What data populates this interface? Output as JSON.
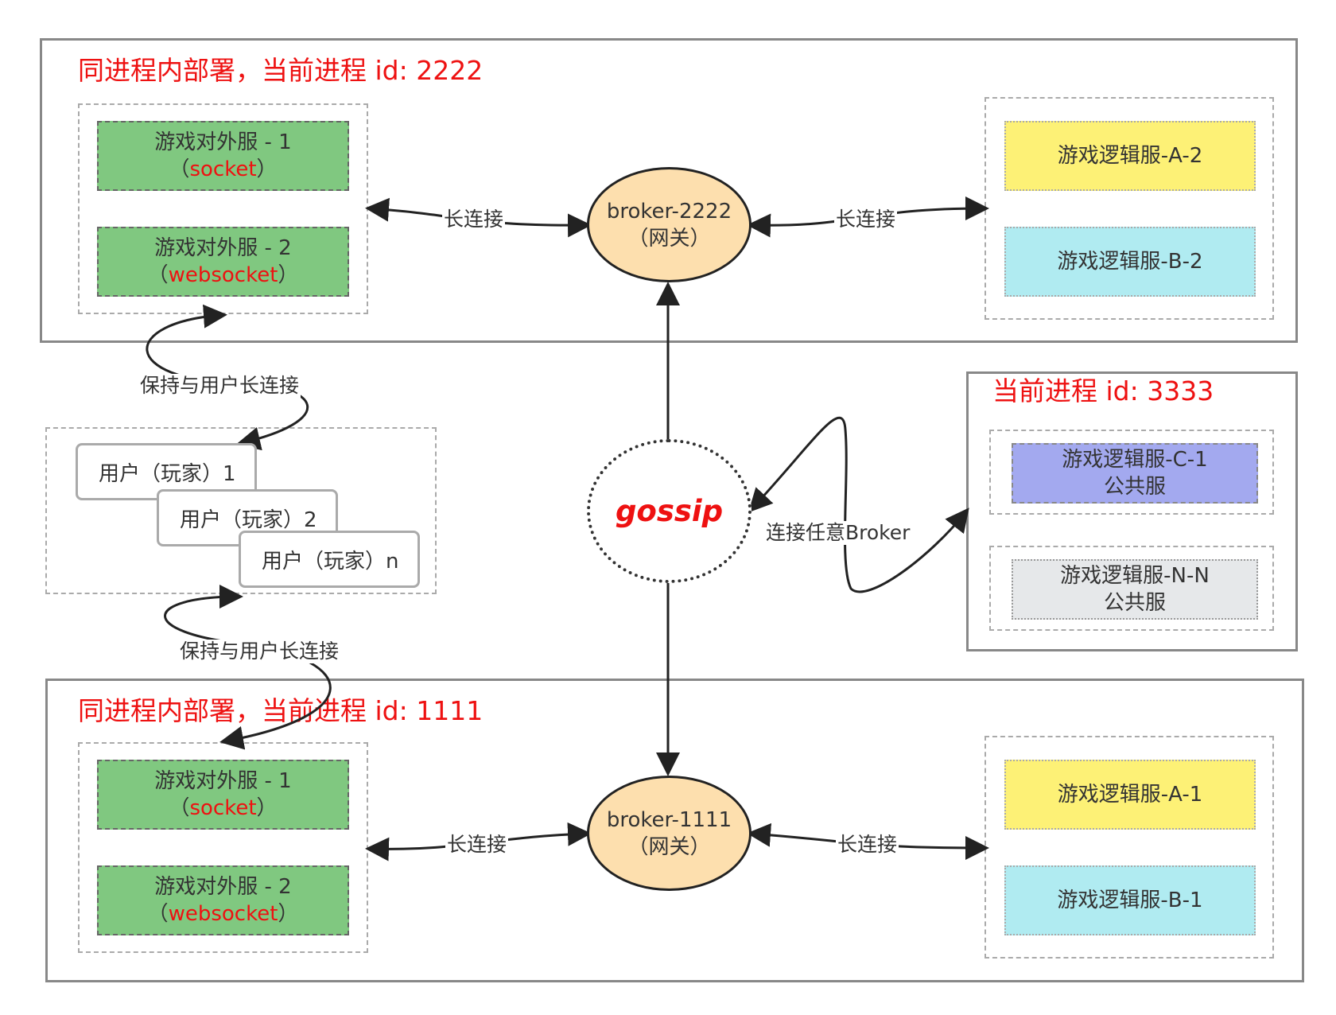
{
  "process_top": {
    "title": "同进程内部署，当前进程 id: 2222"
  },
  "process_bottom": {
    "title": "同进程内部署，当前进程 id: 1111"
  },
  "process_right": {
    "title": "当前进程 id: 3333"
  },
  "external_servers": [
    {
      "line1": "游戏对外服 - 1",
      "paren_open": "（",
      "protocol": "socket",
      "paren_close": "）"
    },
    {
      "line1": "游戏对外服 - 2",
      "paren_open": "（",
      "protocol": "websocket",
      "paren_close": "）"
    }
  ],
  "logic_top": [
    "游戏逻辑服-A-2",
    "游戏逻辑服-B-2"
  ],
  "logic_bottom": [
    "游戏逻辑服-A-1",
    "游戏逻辑服-B-1"
  ],
  "logic_public": [
    {
      "line1": "游戏逻辑服-C-1",
      "line2": "公共服"
    },
    {
      "line1": "游戏逻辑服-N-N",
      "line2": "公共服"
    }
  ],
  "brokers": [
    {
      "name": "broker-2222",
      "sub": "（网关）"
    },
    {
      "name": "broker-1111",
      "sub": "（网关）"
    }
  ],
  "gossip": "gossip",
  "users": [
    "用户（玩家）1",
    "用户（玩家）2",
    "用户（玩家）n"
  ],
  "labels": {
    "long_conn": "长连接",
    "keep_user_conn": "保持与用户长连接",
    "connect_any_broker": "连接任意Broker"
  },
  "colors": {
    "title_red": "#ee1111",
    "external_green": "#80c880",
    "logic_yellow": "#fdf176",
    "logic_cyan": "#b0ebf1",
    "logic_purple": "#a3a9ef",
    "logic_gray": "#e6e8ea",
    "broker_fill": "#fddfae"
  }
}
